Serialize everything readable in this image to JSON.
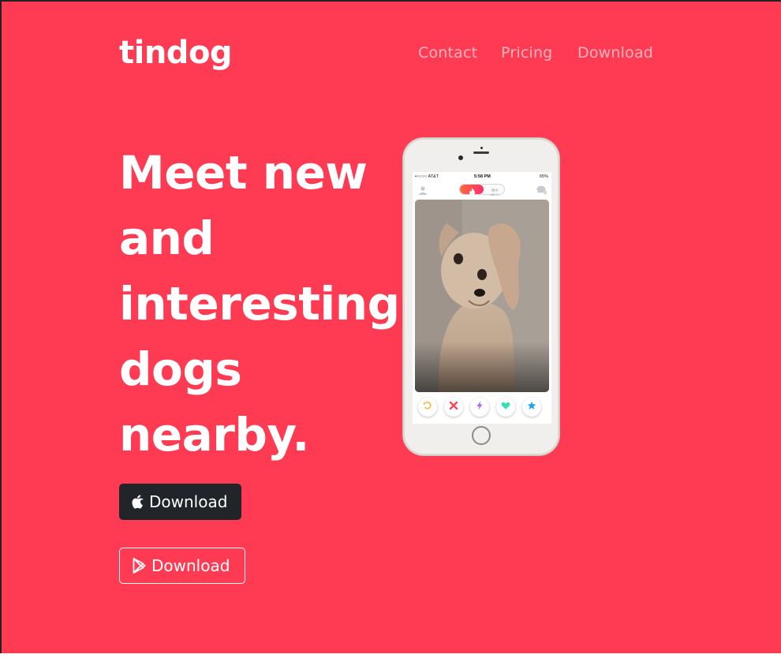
{
  "brand": {
    "name": "tindog"
  },
  "nav": {
    "items": [
      "Contact",
      "Pricing",
      "Download"
    ]
  },
  "hero": {
    "headline_lines": [
      "Meet new",
      "and",
      "interesting",
      "dogs",
      "nearby."
    ],
    "buttons": [
      {
        "label": "Download",
        "icon": "apple-icon"
      },
      {
        "label": "Download",
        "icon": "google-play-icon"
      }
    ]
  },
  "phone": {
    "status_bar": {
      "carrier": "•○○○○ AT&T",
      "time": "5:58 PM",
      "battery": "65%"
    },
    "action_icons": [
      "rewind-icon",
      "nope-x-icon",
      "boost-bolt-icon",
      "like-heart-icon",
      "super-like-star-icon"
    ]
  },
  "colors": {
    "background": "#ff3a53",
    "text": "#ffffff",
    "dark_button": "#212529"
  }
}
